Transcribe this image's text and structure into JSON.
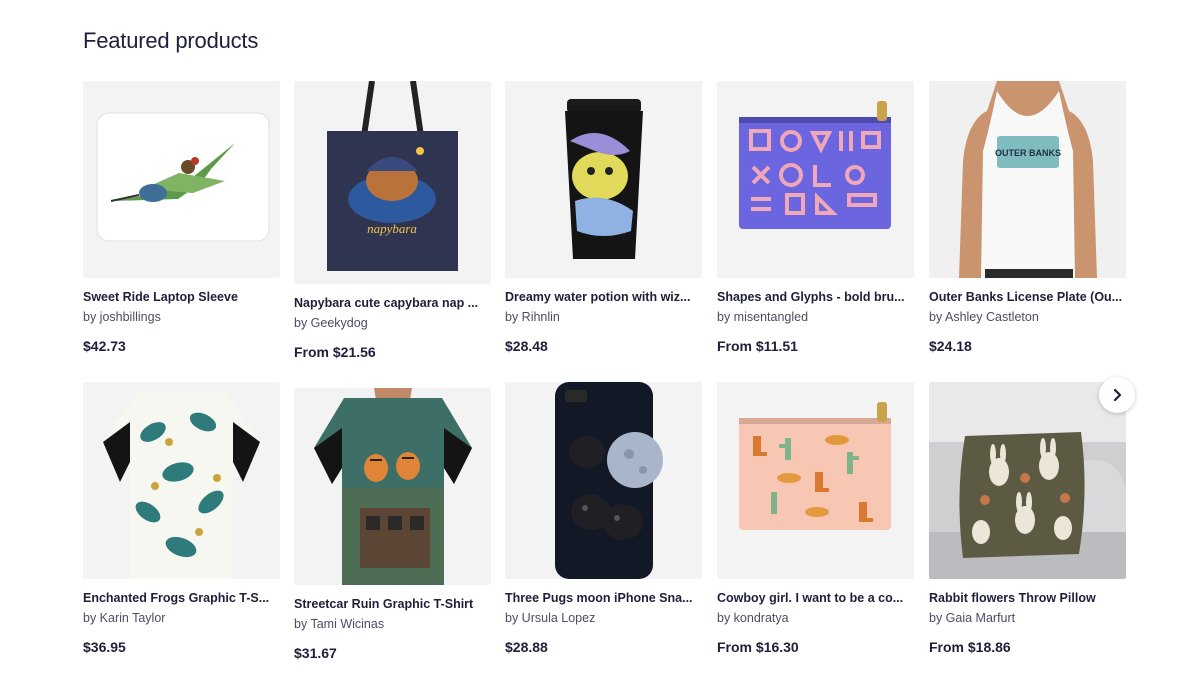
{
  "section": {
    "title": "Featured products"
  },
  "products": [
    {
      "title": "Sweet Ride Laptop Sleeve",
      "artist": "by joshbillings",
      "price": "$42.73",
      "image": "hummingbird-laptop-sleeve"
    },
    {
      "title": "Napybara cute capybara nap ...",
      "artist": "by Geekydog",
      "price": "From $21.56",
      "image": "capybara-tote-bag",
      "image_text": "napybara"
    },
    {
      "title": "Dreamy water potion with wiz...",
      "artist": "by Rihnlin",
      "price": "$28.48",
      "image": "frog-travel-mug"
    },
    {
      "title": "Shapes and Glyphs - bold bru...",
      "artist": "by misentangled",
      "price": "From $11.51",
      "image": "glyphs-zipper-pouch"
    },
    {
      "title": "Outer Banks License Plate (Ou...",
      "artist": "by Ashley Castleton",
      "price": "$24.18",
      "image": "outer-banks-tank-top",
      "image_text": "OUTER BANKS"
    },
    {
      "title": "Enchanted Frogs Graphic T-S...",
      "artist": "by Karin Taylor",
      "price": "$36.95",
      "image": "frogs-graphic-tshirt"
    },
    {
      "title": "Streetcar Ruin Graphic T-Shirt",
      "artist": "by Tami Wicinas",
      "price": "$31.67",
      "image": "tigers-graphic-tshirt"
    },
    {
      "title": "Three Pugs moon iPhone Sna...",
      "artist": "by Ursula Lopez",
      "price": "$28.88",
      "image": "pugs-moon-phone-case"
    },
    {
      "title": "Cowboy girl. I want to be a co...",
      "artist": "by kondratya",
      "price": "From $16.30",
      "image": "cowboy-zipper-pouch"
    },
    {
      "title": "Rabbit flowers Throw Pillow",
      "artist": "by Gaia Marfurt",
      "price": "From $18.86",
      "image": "rabbit-throw-pillow"
    }
  ],
  "carousel": {
    "next_icon": "chevron-right-icon"
  }
}
